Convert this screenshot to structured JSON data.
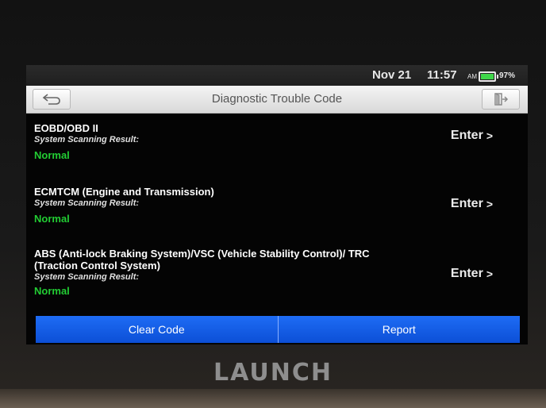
{
  "status_bar": {
    "date": "Nov 21",
    "time": "11:57",
    "ampm": "AM",
    "battery_percent": "97%",
    "battery_level": 0.97,
    "battery_color": "#3fd64a",
    "battery_icon": "battery-icon"
  },
  "header": {
    "title": "Diagnostic Trouble Code",
    "back_icon": "back-arrow-icon",
    "exit_icon": "exit-icon"
  },
  "systems": [
    {
      "name": "EOBD/OBD II",
      "scan_label": "System Scanning Result:",
      "status": "Normal",
      "enter_label": "Enter"
    },
    {
      "name": "ECMTCM (Engine and Transmission)",
      "scan_label": "System Scanning Result:",
      "status": "Normal",
      "enter_label": "Enter"
    },
    {
      "name": "ABS (Anti-lock Braking System)/VSC (Vehicle Stability Control)/ TRC (Traction Control System)",
      "scan_label": "System Scanning Result:",
      "status": "Normal",
      "enter_label": "Enter"
    }
  ],
  "footer": {
    "clear_code_label": "Clear Code",
    "report_label": "Report"
  },
  "brand": "LAUNCH",
  "colors": {
    "accent_blue": "#1e6cf5",
    "status_normal": "#22cc33"
  }
}
